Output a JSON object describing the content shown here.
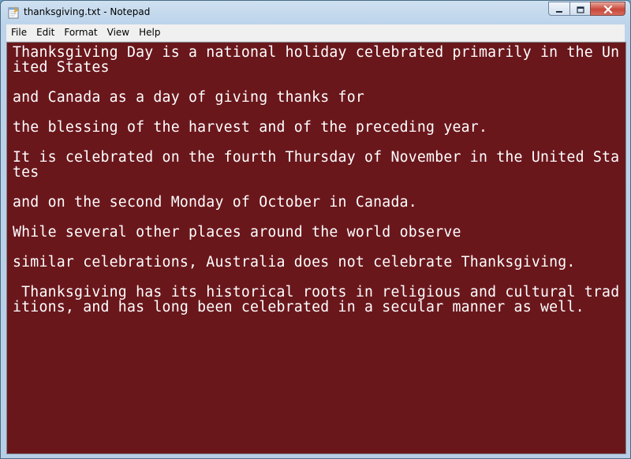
{
  "window": {
    "title": "thanksgiving.txt - Notepad"
  },
  "icons": {
    "app": "notepad-icon",
    "minimize": "minimize-icon",
    "maximize": "maximize-icon",
    "close": "close-icon"
  },
  "menu": {
    "items": [
      "File",
      "Edit",
      "Format",
      "View",
      "Help"
    ]
  },
  "editor": {
    "content": "Thanksgiving Day is a national holiday celebrated primarily in the United States\n\nand Canada as a day of giving thanks for\n\nthe blessing of the harvest and of the preceding year.\n\nIt is celebrated on the fourth Thursday of November in the United States\n\nand on the second Monday of October in Canada.\n\nWhile several other places around the world observe\n\nsimilar celebrations, Australia does not celebrate Thanksgiving.\n\n Thanksgiving has its historical roots in religious and cultural traditions, and has long been celebrated in a secular manner as well."
  },
  "colors": {
    "editor_background": "#6a171c",
    "editor_text": "#ffffff",
    "close_button": "#c9473a"
  }
}
